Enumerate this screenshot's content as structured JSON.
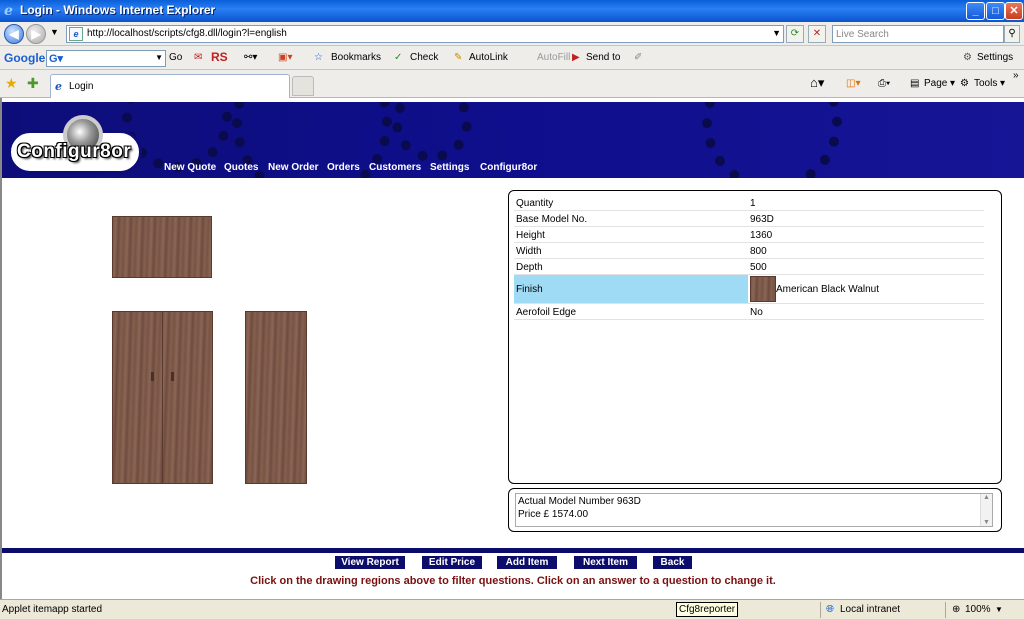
{
  "window": {
    "title": "Login - Windows Internet Explorer"
  },
  "address_bar": {
    "url": "http://localhost/scripts/cfg8.dll/login?l=english"
  },
  "search": {
    "placeholder": "Live Search"
  },
  "google_toolbar": {
    "logo": "Google",
    "go_label": "Go",
    "rs_label": "RS",
    "bookmarks_label": "Bookmarks",
    "check_label": "Check",
    "autolink_label": "AutoLink",
    "autofill_label": "AutoFill",
    "sendto_label": "Send to",
    "settings_label": "Settings"
  },
  "tab": {
    "label": "Login"
  },
  "command_bar": {
    "page_label": "Page",
    "tools_label": "Tools"
  },
  "app": {
    "logo_text": "Configur8or",
    "nav": [
      "New Quote",
      "Quotes",
      "New Order",
      "Orders",
      "Customers",
      "Settings",
      "Configur8or"
    ]
  },
  "questions": [
    {
      "label": "Quantity",
      "value": "1"
    },
    {
      "label": "Base Model No.",
      "value": "963D"
    },
    {
      "label": "Height",
      "value": "1360"
    },
    {
      "label": "Width",
      "value": "800"
    },
    {
      "label": "Depth",
      "value": "500"
    },
    {
      "label": "Finish",
      "value": "American Black Walnut",
      "selected": true
    },
    {
      "label": "Aerofoil Edge",
      "value": "No"
    }
  ],
  "info": {
    "model_line": "Actual Model Number 963D",
    "price_line": "Price  £ 1574.00"
  },
  "actions": [
    "View Report",
    "Edit Price",
    "Add Item",
    "Next Item",
    "Back"
  ],
  "hint": "Click on the drawing regions above to filter questions. Click on an answer to a question to change it.",
  "status": {
    "left_text": "Applet itemapp started",
    "tooltip": "Cfg8reporter",
    "zone": "Local intranet",
    "zoom": "100%"
  },
  "colors": {
    "banner": "#0f0f8d",
    "selected_row": "#a0dbf6",
    "hint_text": "#7a1010",
    "button_bg": "#0c0c6c"
  }
}
